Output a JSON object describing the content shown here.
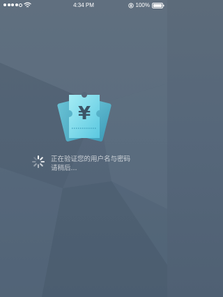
{
  "status_bar": {
    "time": "4:34 PM",
    "battery": "100%",
    "signal_bars_filled": 4,
    "signal_bars_total": 5,
    "battery_level": 1.0
  },
  "loading": {
    "line1": "正在验证您的用户名与密码",
    "line2": "请稍后..."
  },
  "icons": {
    "ticket": "yen-ticket-icon",
    "spinner": "loading-spinner-icon"
  },
  "colors": {
    "background": "#56677a",
    "ticket_front": "#6fd6e8",
    "ticket_back": "#4bb7d2",
    "text": "#e9edf1"
  },
  "symbols": {
    "currency": "¥"
  }
}
